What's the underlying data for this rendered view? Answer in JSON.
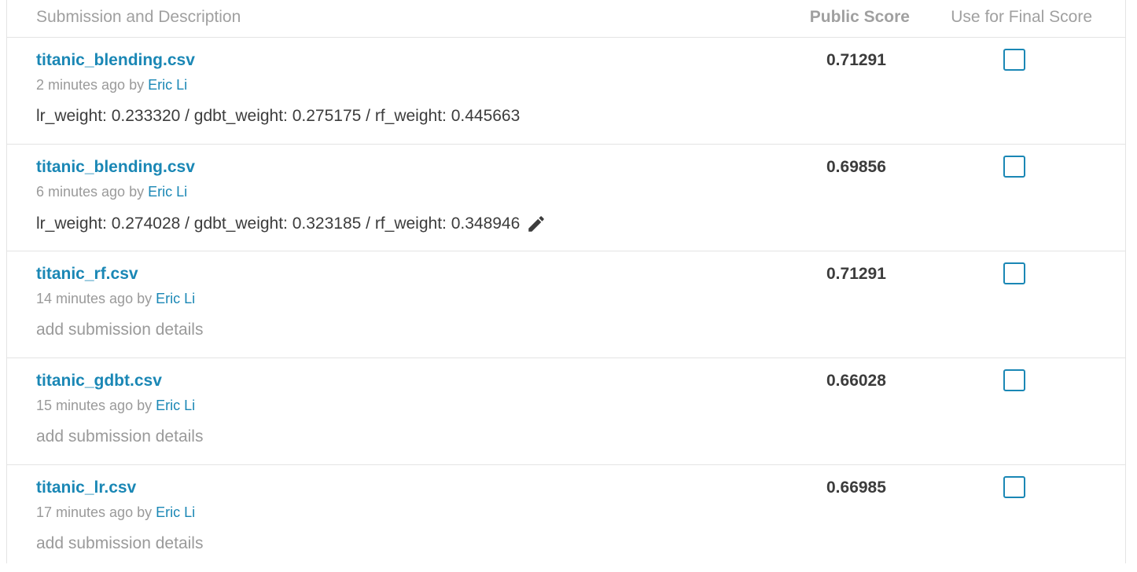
{
  "header": {
    "description_label": "Submission and Description",
    "public_score_label": "Public Score",
    "final_score_label": "Use for Final Score"
  },
  "submissions": [
    {
      "filename": "titanic_blending.csv",
      "time": "2 minutes ago by",
      "author": "Eric Li",
      "description": "lr_weight: 0.233320 / gdbt_weight: 0.275175 / rf_weight: 0.445663",
      "score": "0.71291",
      "use_for_final": false
    },
    {
      "filename": "titanic_blending.csv",
      "time": "6 minutes ago by",
      "author": "Eric Li",
      "description": "lr_weight: 0.274028 / gdbt_weight: 0.323185 / rf_weight: 0.348946",
      "score": "0.69856",
      "use_for_final": false
    },
    {
      "filename": "titanic_rf.csv",
      "time": "14 minutes ago by",
      "author": "Eric Li",
      "description": "add submission details",
      "score": "0.71291",
      "use_for_final": false
    },
    {
      "filename": "titanic_gdbt.csv",
      "time": "15 minutes ago by",
      "author": "Eric Li",
      "description": "add submission details",
      "score": "0.66028",
      "use_for_final": false
    },
    {
      "filename": "titanic_lr.csv",
      "time": "17 minutes ago by",
      "author": "Eric Li",
      "description": "add submission details",
      "score": "0.66985",
      "use_for_final": false
    }
  ],
  "icons": {
    "edit": "pencil-icon"
  },
  "colors": {
    "link": "#1a87b5",
    "muted": "#9a9a9a",
    "text": "#3c3c3c"
  }
}
